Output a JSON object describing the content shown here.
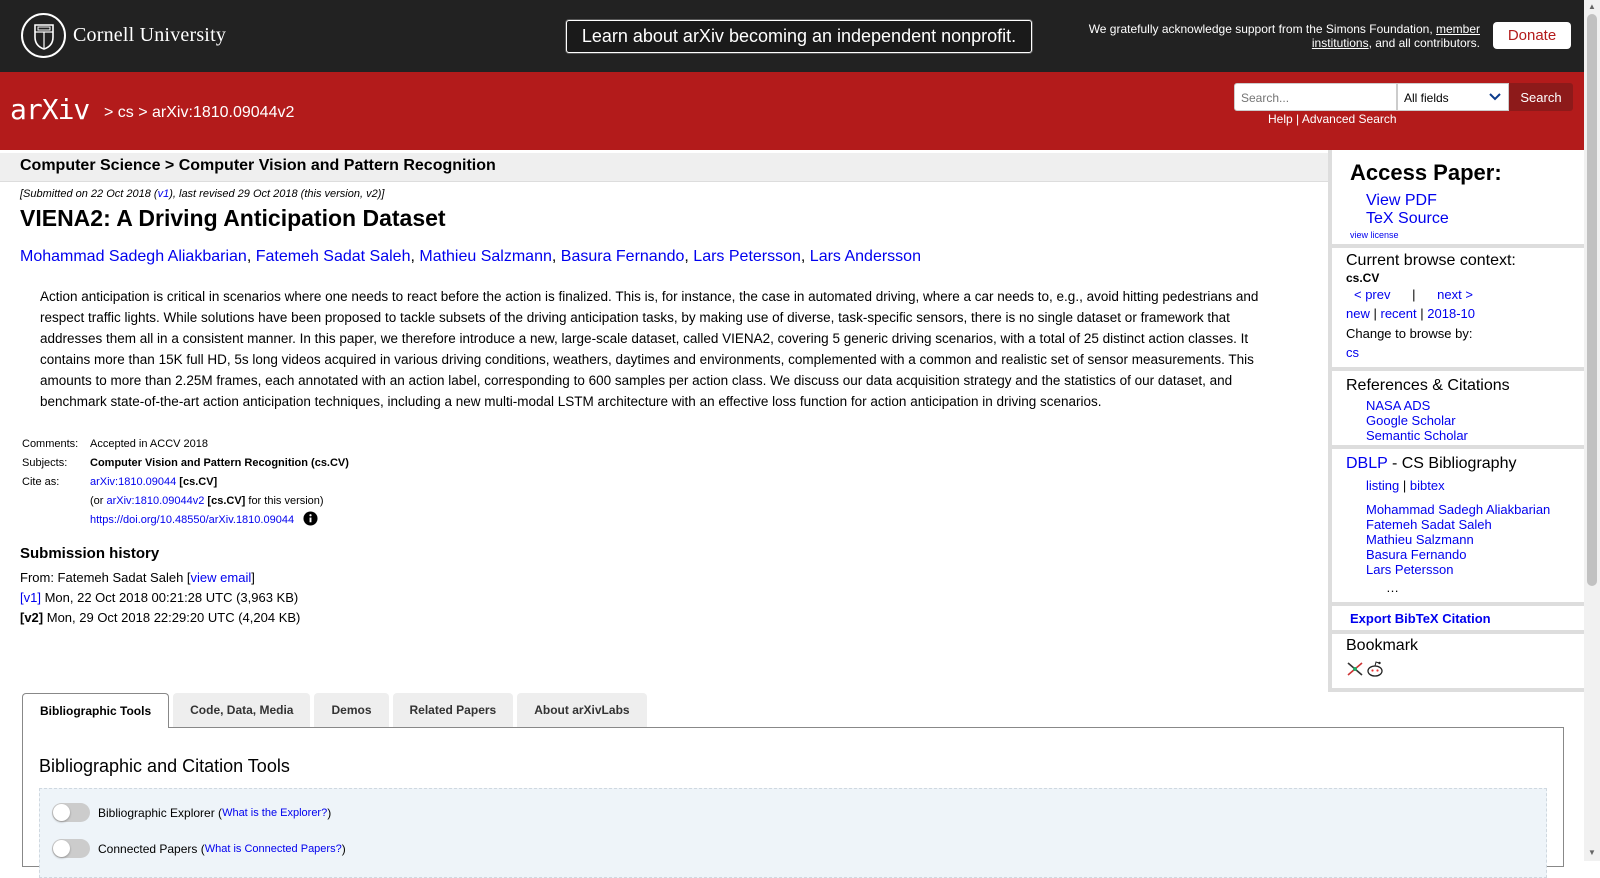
{
  "topbar": {
    "university": "Cornell University",
    "announcement": "Learn about arXiv becoming an independent nonprofit.",
    "support_prefix": "We gratefully acknowledge support from the Simons Foundation, ",
    "support_link": "member institutions",
    "support_suffix": ", and all contributors.",
    "donate_label": "Donate"
  },
  "header": {
    "logo_text": "arXiv",
    "crumb_sep1": " > ",
    "crumb_cs": "cs",
    "crumb_sep2": " > ",
    "crumb_id": "arXiv:1810.09044v2",
    "search_placeholder": "Search...",
    "field_selected": "All fields",
    "search_button": "Search",
    "help_link": "Help",
    "help_sep": " | ",
    "advanced_link": "Advanced Search"
  },
  "paper": {
    "subject_header": "Computer Science > Computer Vision and Pattern Recognition",
    "dateline_pre": "[Submitted on 22 Oct 2018 (",
    "dateline_v1": "v1",
    "dateline_post": "), last revised 29 Oct 2018 (this version, v2)]",
    "title": "VIENA2: A Driving Anticipation Dataset",
    "authors": [
      "Mohammad Sadegh Aliakbarian",
      "Fatemeh Sadat Saleh",
      "Mathieu Salzmann",
      "Basura Fernando",
      "Lars Petersson",
      "Lars Andersson"
    ],
    "author_sep": ", ",
    "abstract": "Action anticipation is critical in scenarios where one needs to react before the action is finalized. This is, for instance, the case in automated driving, where a car needs to, e.g., avoid hitting pedestrians and respect traffic lights. While solutions have been proposed to tackle subsets of the driving anticipation tasks, by making use of diverse, task-specific sensors, there is no single dataset or framework that addresses them all in a consistent manner. In this paper, we therefore introduce a new, large-scale dataset, called VIENA2, covering 5 generic driving scenarios, with a total of 25 distinct action classes. It contains more than 15K full HD, 5s long videos acquired in various driving conditions, weathers, daytimes and environments, complemented with a common and realistic set of sensor measurements. This amounts to more than 2.25M frames, each annotated with an action label, corresponding to 600 samples per action class. We discuss our data acquisition strategy and the statistics of our dataset, and benchmark state-of-the-art action anticipation techniques, including a new multi-modal LSTM architecture with an effective loss function for action anticipation in driving scenarios.",
    "comments_label": "Comments:",
    "comments_value": "Accepted in ACCV 2018",
    "subjects_label": "Subjects:",
    "subjects_value": "Computer Vision and Pattern Recognition (cs.CV)",
    "cite_label": "Cite as:",
    "cite_id": "arXiv:1810.09044",
    "cite_tag": " [cs.CV]",
    "cite_alt_pre": "(or ",
    "cite_alt_id": "arXiv:1810.09044v2",
    "cite_alt_tag": " [cs.CV]",
    "cite_alt_post": " for this version)",
    "doi": "https://doi.org/10.48550/arXiv.1810.09044",
    "history_heading": "Submission history",
    "history_from_pre": "From: Fatemeh Sadat Saleh [",
    "history_view_email": "view email",
    "history_from_post": "]",
    "v1_label": "[v1]",
    "v1_text": " Mon, 22 Oct 2018 00:21:28 UTC (3,963 KB)",
    "v2_label": "[v2]",
    "v2_text": " Mon, 29 Oct 2018 22:29:20 UTC (4,204 KB)"
  },
  "sidebar": {
    "access_heading": "Access Paper:",
    "view_pdf": "View PDF",
    "tex_source": "TeX Source",
    "view_license": "view license",
    "browse_heading": "Current browse context:",
    "browse_cat": "cs.CV",
    "prev": "< prev",
    "nav_sep": "|",
    "next": "next >",
    "new": "new",
    "recent": "recent",
    "month": "2018-10",
    "change_label": "Change to browse by:",
    "change_cs": "cs",
    "refs_heading": "References & Citations",
    "refs": [
      "NASA ADS",
      "Google Scholar",
      "Semantic Scholar"
    ],
    "dblp_link": "DBLP",
    "dblp_rest": " - CS Bibliography",
    "listing": "listing",
    "bibtex": "bibtex",
    "dblp_authors": [
      "Mohammad Sadegh Aliakbarian",
      "Fatemeh Sadat Saleh",
      "Mathieu Salzmann",
      "Basura Fernando",
      "Lars Petersson"
    ],
    "ellipsis": "…",
    "export": "Export BibTeX Citation",
    "bookmark_heading": "Bookmark"
  },
  "tabs": {
    "items": [
      "Bibliographic Tools",
      "Code, Data, Media",
      "Demos",
      "Related Papers",
      "About arXivLabs"
    ],
    "active": 0,
    "panel_title": "Bibliographic and Citation Tools",
    "explorer_label": "Bibliographic Explorer (",
    "explorer_link": "What is the Explorer?",
    "explorer_close": ")",
    "connected_label": "Connected Papers (",
    "connected_link": "What is Connected Papers?",
    "connected_close": ")"
  },
  "colors": {
    "arxiv_red": "#b31b1b",
    "topbar_bg": "#222222",
    "link_blue": "#0000ee"
  }
}
